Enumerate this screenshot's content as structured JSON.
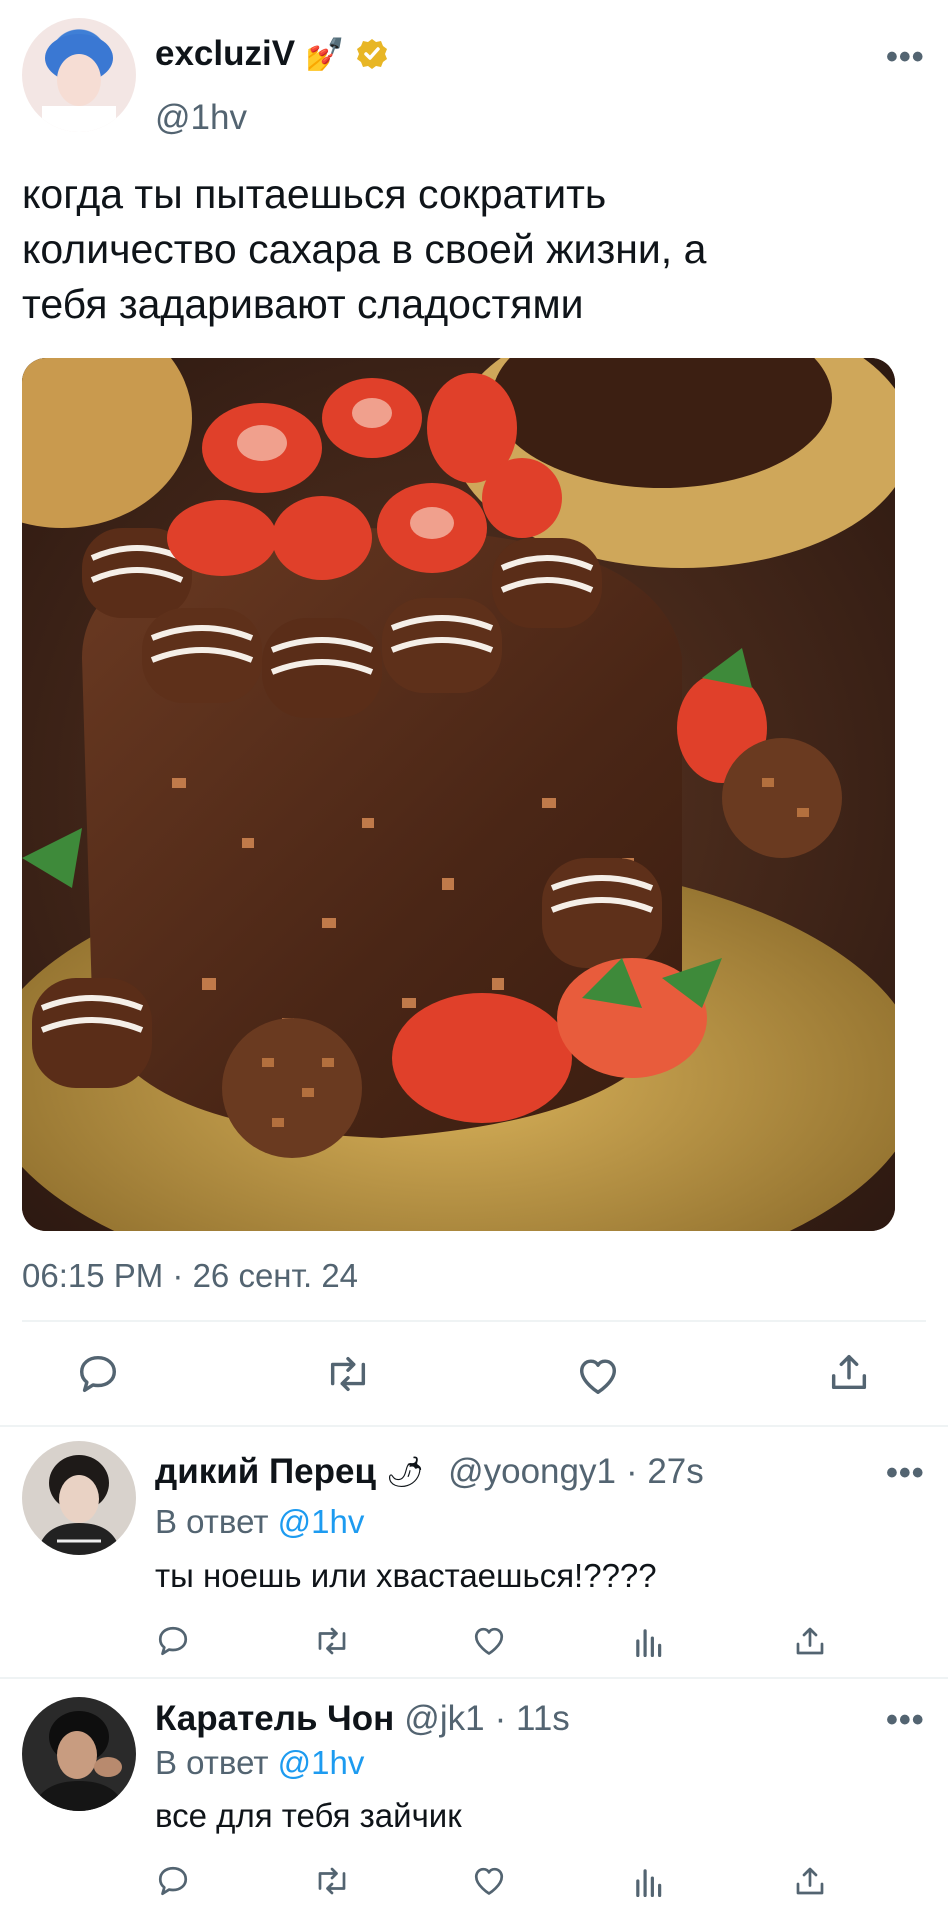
{
  "tweet": {
    "author": {
      "name": "excluziV",
      "handle": "@1hv",
      "name_emoji": "💅"
    },
    "text": "когда ты пытаешься сократить количество сахара в своей  жизни, а тебя задаривают сладостями",
    "text_lines": [
      "когда ты пытаешься сократить",
      "количество сахара в своей  жизни, а",
      "тебя задаривают сладостями"
    ],
    "timestamp": "06:15 PM · 26 сент. 24",
    "image_subject": "chocolate-cake-with-strawberries"
  },
  "actions": [
    "reply-icon",
    "retweet-icon",
    "like-icon",
    "share-icon"
  ],
  "replies": [
    {
      "name": "дикий Перец",
      "name_emoji": "🌶",
      "handle": "@yoongy1",
      "time": "· 27s",
      "reply_prefix": "В ответ",
      "reply_to": "@1hv",
      "text": "ты ноешь или хвастаешься!????"
    },
    {
      "name": "Каратель Чон",
      "name_emoji": "",
      "handle": "@jk1",
      "time": "· 11s",
      "reply_prefix": "В ответ",
      "reply_to": "@1hv",
      "text": "все для тебя зайчик"
    }
  ],
  "colors": {
    "accent": "#1d9bf0",
    "muted": "#536471",
    "verified": "#e8b625",
    "divider": "#eff3f4"
  }
}
